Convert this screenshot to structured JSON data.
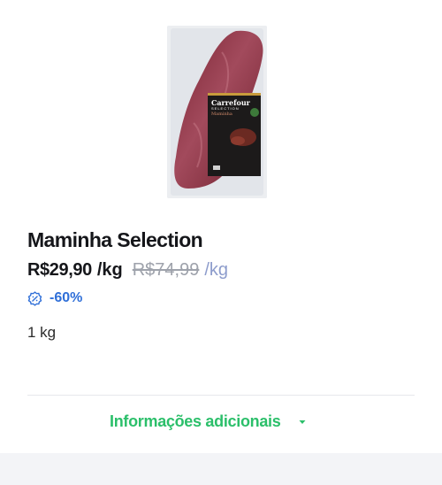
{
  "product": {
    "name": "Maminha Selection",
    "price": "R$29,90",
    "price_unit": "/kg",
    "old_price": "R$74,99",
    "old_price_unit": "/kg",
    "discount": "-60%",
    "weight": "1 kg",
    "package": {
      "brand": "Carrefour",
      "line": "SELECTION",
      "label": "Maminha"
    }
  },
  "additional_info": {
    "label": "Informações adicionais",
    "icon": "chevron-down-icon"
  },
  "colors": {
    "accent_green": "#2bbf6a",
    "discount_blue": "#2f6fd8",
    "old_price_gray": "#9ea2ab"
  }
}
